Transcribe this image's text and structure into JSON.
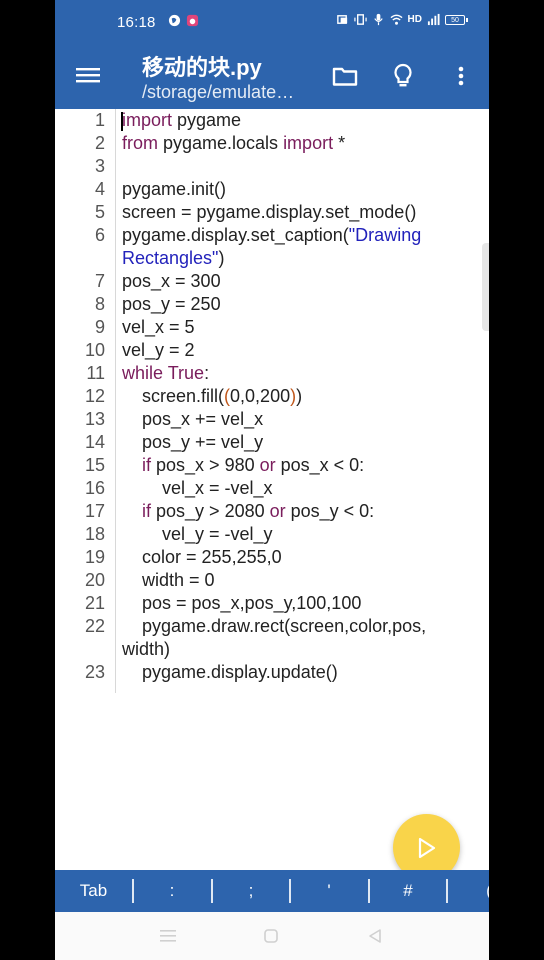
{
  "status": {
    "time": "16:18",
    "network": "HD",
    "battery": "50"
  },
  "appbar": {
    "title": "移动的块.py",
    "subtitle": "/storage/emulate…",
    "icons": [
      "menu-icon",
      "folder-icon",
      "lightbulb-icon",
      "more-vert-icon"
    ]
  },
  "editor": {
    "line_numbers": [
      "1",
      "2",
      "3",
      "4",
      "5",
      "6",
      "7",
      "8",
      "9",
      "10",
      "11",
      "12",
      "13",
      "14",
      "15",
      "16",
      "17",
      "18",
      "19",
      "20",
      "21",
      "22",
      "23"
    ]
  },
  "keys": [
    "Tab",
    ":",
    ";",
    "'",
    "#",
    "("
  ],
  "colors": {
    "primary": "#2d64ad",
    "fab": "#f9d44a",
    "keyword": "#7a1d5c",
    "string": "#2222bb"
  }
}
